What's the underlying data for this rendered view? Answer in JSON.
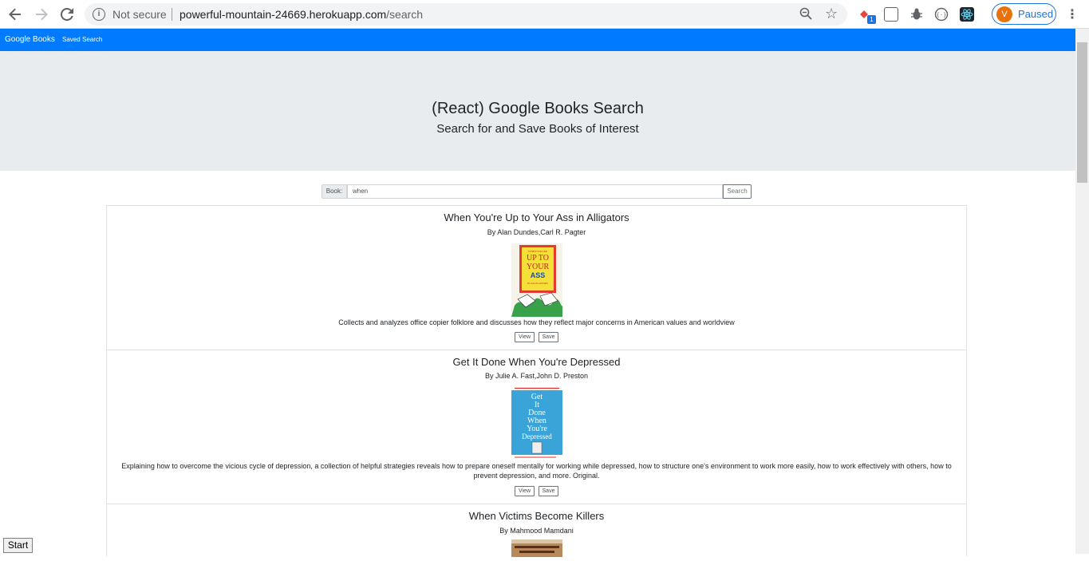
{
  "browser": {
    "security_label": "Not secure",
    "url_domain": "powerful-mountain-24669.herokuapp.com",
    "url_path": "/search",
    "profile_initial": "V",
    "profile_label": "Paused",
    "extension_badge": "1"
  },
  "navbar": {
    "brand": "Google Books",
    "links": [
      "Saved",
      "Search"
    ]
  },
  "jumbotron": {
    "title": "(React) Google Books Search",
    "subtitle": "Search for and Save Books of Interest"
  },
  "search": {
    "label": "Book:",
    "value": "when",
    "button": "Search"
  },
  "books": [
    {
      "title": "When You're Up to Your Ass in Alligators",
      "authors": "By Alan Dundes,Carl R. Pagter",
      "cover_text": [
        "WHEN YOU'RE",
        "UP TO",
        "YOUR",
        "ASS",
        "IN ALLIGATORS"
      ],
      "description": "Collects and analyzes office copier folklore and discusses how they reflect major concerns in American values and worldview",
      "view": "View",
      "save": "Save"
    },
    {
      "title": "Get It Done When You're Depressed",
      "authors": "By Julie A. Fast,John D. Preston",
      "cover_text": [
        "Get",
        "It",
        "Done",
        "When",
        "You're",
        "Depressed"
      ],
      "description": "Explaining how to overcome the vicious cycle of depression, a collection of helpful strategies reveals how to prepare oneself mentally for working while depressed, how to structure one's environment to work more easily, how to work effectively with others, how to prevent depression, and more. Original.",
      "view": "View",
      "save": "Save"
    },
    {
      "title": "When Victims Become Killers",
      "authors": "By Mahmood Mamdani"
    }
  ],
  "taskbar": {
    "start": "Start"
  }
}
